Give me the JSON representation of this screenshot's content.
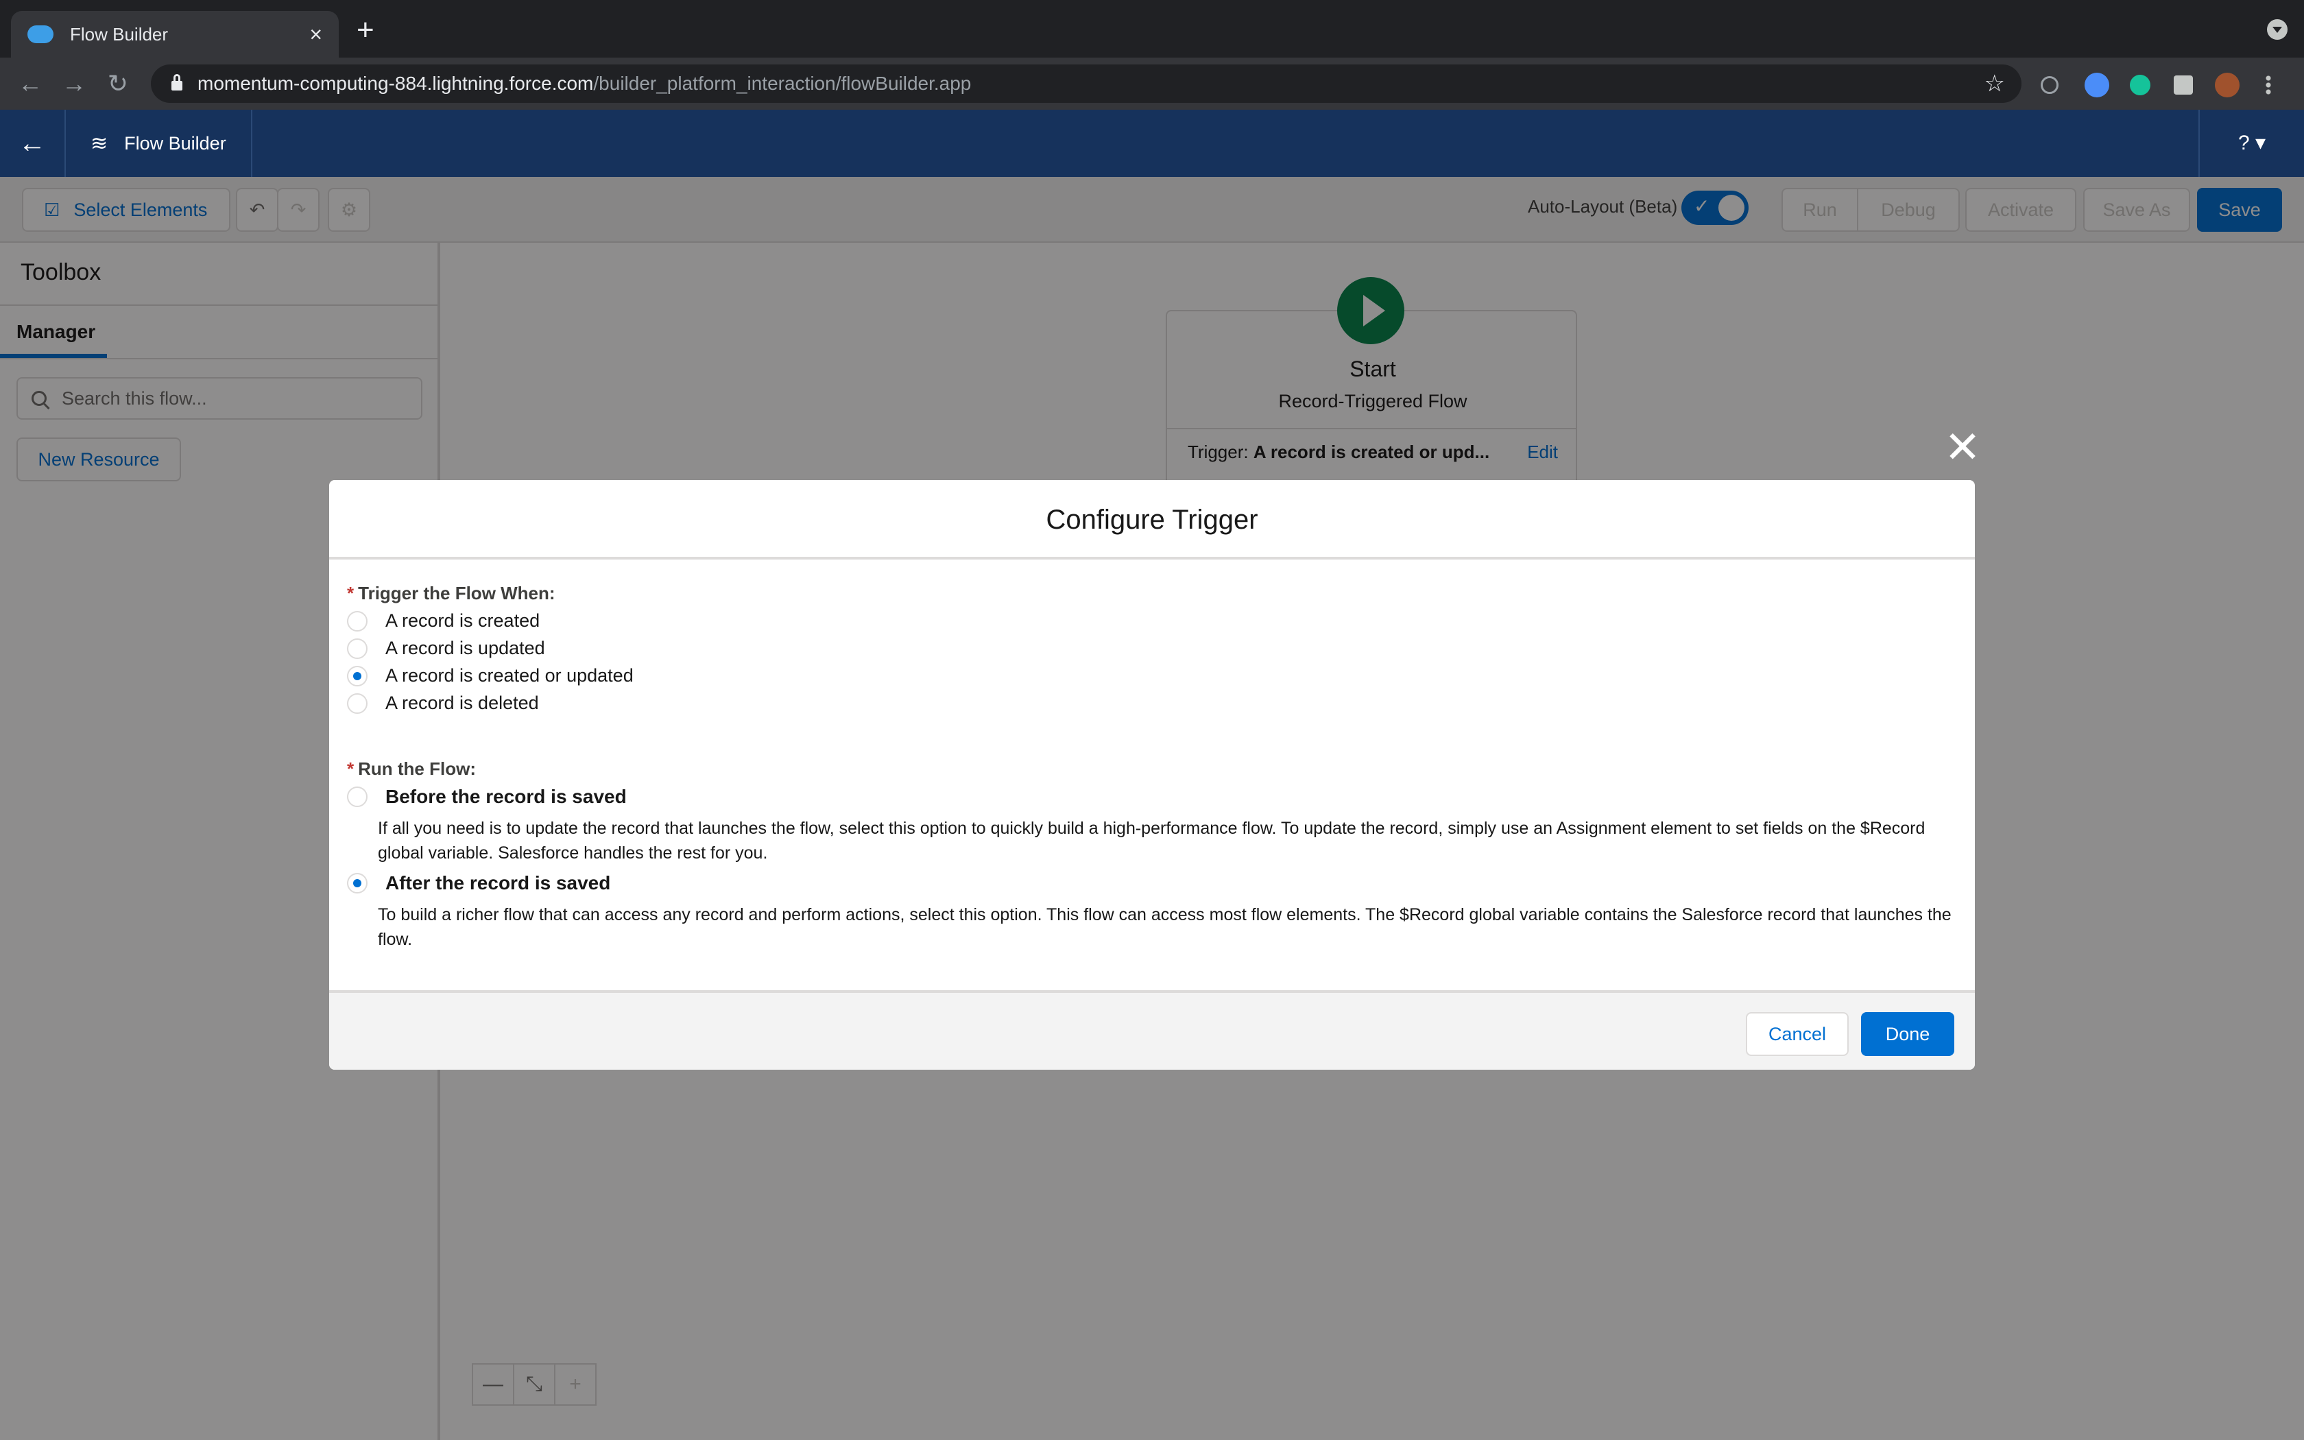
{
  "browser": {
    "tab_title": "Flow Builder",
    "tab_close": "×",
    "new_tab": "+",
    "url_host": "momentum-computing-884.lightning.force.com",
    "url_path": "/builder_platform_interaction/flowBuilder.app"
  },
  "header": {
    "back": "←",
    "title": "Flow Builder",
    "title_icon": "≋",
    "help": "? ▾"
  },
  "toolbar": {
    "select_elements": "Select Elements",
    "undo": "↶",
    "redo": "↷",
    "settings": "⚙",
    "autolayout_label": "Auto-Layout (Beta)",
    "autolayout_on": true,
    "run": "Run",
    "debug": "Debug",
    "activate": "Activate",
    "save_as": "Save As",
    "save": "Save"
  },
  "toolbox": {
    "title": "Toolbox",
    "tab": "Manager",
    "search_placeholder": "Search this flow...",
    "new_resource": "New Resource"
  },
  "canvas": {
    "start_label": "Start",
    "start_sub": "Record-Triggered Flow",
    "trigger_label": "Trigger:",
    "trigger_value": "A record is created or upd...",
    "edit": "Edit",
    "zoom_out": "—",
    "fit": "⤡",
    "zoom_in": "+"
  },
  "modal": {
    "close": "✕",
    "title": "Configure Trigger",
    "trigger_label": "Trigger the Flow When:",
    "trigger_options": [
      {
        "label": "A record is created",
        "checked": false
      },
      {
        "label": "A record is updated",
        "checked": false
      },
      {
        "label": "A record is created or updated",
        "checked": true
      },
      {
        "label": "A record is deleted",
        "checked": false
      }
    ],
    "run_label": "Run the Flow:",
    "run_options": [
      {
        "label": "Before the record is saved",
        "checked": false,
        "description": "If all you need is to update the record that launches the flow, select this option to quickly build a high-performance flow. To update the record, simply use an Assignment element to set fields on the $Record global variable. Salesforce handles the rest for you."
      },
      {
        "label": "After the record is saved",
        "checked": true,
        "description": "To build a richer flow that can access any record and perform actions, select this option. This flow can access most flow elements. The $Record global variable contains the Salesforce record that launches the flow."
      }
    ],
    "cancel": "Cancel",
    "done": "Done"
  },
  "colors": {
    "brand": "#0070d2",
    "header": "#16325c",
    "start_node": "#04844b",
    "required": "#c23934"
  }
}
